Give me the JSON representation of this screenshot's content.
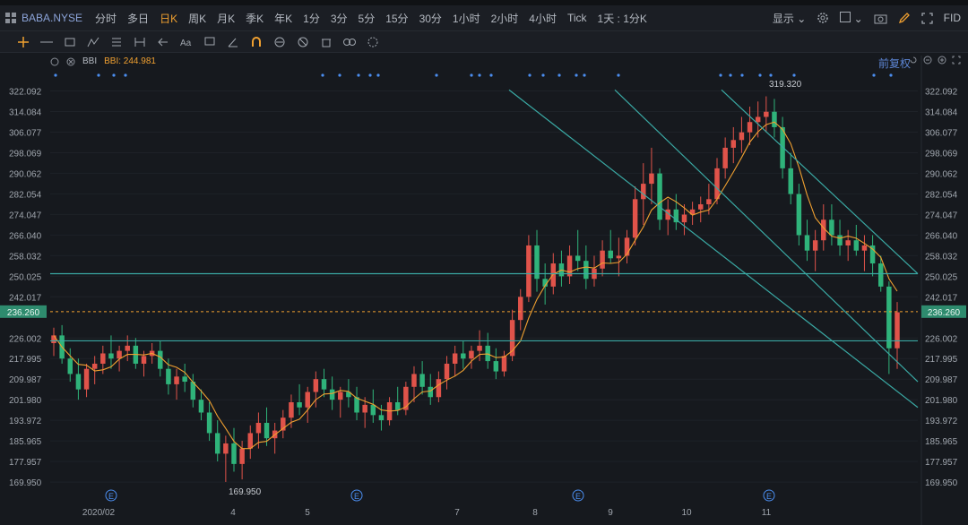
{
  "header": {
    "symbol": "BABA.NYSE",
    "timeframes": [
      "分时",
      "多日",
      "日K",
      "周K",
      "月K",
      "季K",
      "年K",
      "1分",
      "3分",
      "5分",
      "15分",
      "30分",
      "1小时",
      "2小时",
      "4小时",
      "Tick",
      "1天 : 1分K"
    ],
    "active_timeframe": "日K",
    "display_label": "显示",
    "fid_label": "FID"
  },
  "indicator": {
    "name": "BBI",
    "value_label": "BBI: 244.981"
  },
  "adjust_label": "前复权",
  "colors": {
    "up": "#e0534a",
    "down": "#2fb37a",
    "ma": "#f0a030",
    "trendline": "#3aa9a4",
    "price_tag": "#2e8b6e",
    "axis_text": "#a0a6ae",
    "background": "#16191e",
    "marker_dot": "#4b8ef0"
  },
  "chart_data": {
    "type": "candlestick",
    "yticks": [
      322.092,
      314.084,
      306.077,
      298.069,
      290.062,
      282.054,
      274.047,
      266.04,
      258.032,
      250.025,
      242.017,
      226.002,
      217.995,
      209.987,
      201.98,
      193.972,
      185.965,
      177.957,
      169.95
    ],
    "ylim": [
      166.5,
      327.5
    ],
    "xtick_labels": [
      "2020/02",
      "4",
      "5",
      "7",
      "8",
      "9",
      "10",
      "11"
    ],
    "current_price": "236.260",
    "annotations": [
      {
        "text": "319.320",
        "kind": "high",
        "value": 319.32
      },
      {
        "text": "169.950",
        "kind": "low",
        "value": 169.95
      }
    ],
    "earnings_marker": "E",
    "horizontal_lines": [
      251.0,
      224.9
    ],
    "channel_lines": [
      {
        "from": [
          "2020-07-08",
          322.5
        ],
        "to": [
          "2020-12-15",
          199.0
        ]
      },
      {
        "from": [
          "2020-09-07",
          322.5
        ],
        "to": [
          "2020-12-15",
          209.0
        ]
      },
      {
        "from": [
          "2020-10-19",
          322.5
        ],
        "to": [
          "2020-12-15",
          251.0
        ]
      }
    ],
    "ohlc": [
      [
        224,
        230,
        219,
        227
      ],
      [
        227,
        231,
        216,
        218
      ],
      [
        218,
        222,
        209,
        212
      ],
      [
        212,
        218,
        202,
        206
      ],
      [
        206,
        216,
        203,
        214
      ],
      [
        214,
        219,
        208,
        216
      ],
      [
        216,
        223,
        212,
        220
      ],
      [
        220,
        227,
        214,
        218
      ],
      [
        218,
        223,
        213,
        221
      ],
      [
        221,
        227,
        217,
        223
      ],
      [
        223,
        226,
        214,
        216
      ],
      [
        216,
        221,
        211,
        219
      ],
      [
        219,
        224,
        216,
        221
      ],
      [
        221,
        225,
        211,
        214
      ],
      [
        214,
        218,
        204,
        208
      ],
      [
        208,
        214,
        202,
        211
      ],
      [
        211,
        216,
        205,
        209
      ],
      [
        209,
        212,
        199,
        202
      ],
      [
        202,
        206,
        194,
        197
      ],
      [
        197,
        201,
        186,
        189
      ],
      [
        189,
        194,
        178,
        181
      ],
      [
        181,
        188,
        170,
        185
      ],
      [
        185,
        191,
        174,
        177
      ],
      [
        177,
        186,
        171,
        183
      ],
      [
        183,
        192,
        179,
        189
      ],
      [
        189,
        197,
        183,
        193
      ],
      [
        193,
        199,
        184,
        187
      ],
      [
        187,
        193,
        181,
        190
      ],
      [
        190,
        198,
        187,
        195
      ],
      [
        195,
        204,
        191,
        201
      ],
      [
        201,
        208,
        196,
        199
      ],
      [
        199,
        207,
        193,
        205
      ],
      [
        205,
        213,
        199,
        210
      ],
      [
        210,
        214,
        203,
        206
      ],
      [
        206,
        211,
        198,
        202
      ],
      [
        202,
        207,
        195,
        205
      ],
      [
        205,
        210,
        199,
        203
      ],
      [
        203,
        207,
        194,
        197
      ],
      [
        197,
        203,
        191,
        200
      ],
      [
        200,
        206,
        193,
        196
      ],
      [
        196,
        200,
        190,
        194
      ],
      [
        194,
        203,
        192,
        201
      ],
      [
        201,
        207,
        196,
        198
      ],
      [
        198,
        209,
        196,
        207
      ],
      [
        207,
        215,
        201,
        212
      ],
      [
        212,
        217,
        204,
        207
      ],
      [
        207,
        212,
        200,
        203
      ],
      [
        203,
        213,
        201,
        210
      ],
      [
        210,
        219,
        206,
        216
      ],
      [
        216,
        223,
        211,
        220
      ],
      [
        220,
        225,
        214,
        218
      ],
      [
        218,
        223,
        214,
        221
      ],
      [
        221,
        229,
        217,
        223
      ],
      [
        223,
        228,
        214,
        217
      ],
      [
        217,
        222,
        210,
        213
      ],
      [
        213,
        221,
        211,
        219
      ],
      [
        219,
        237,
        217,
        233
      ],
      [
        233,
        245,
        229,
        242
      ],
      [
        242,
        266,
        240,
        262
      ],
      [
        262,
        268,
        244,
        249
      ],
      [
        249,
        255,
        239,
        246
      ],
      [
        246,
        259,
        243,
        255
      ],
      [
        255,
        260,
        246,
        250
      ],
      [
        250,
        262,
        247,
        258
      ],
      [
        258,
        268,
        252,
        256
      ],
      [
        256,
        262,
        245,
        249
      ],
      [
        249,
        258,
        246,
        253
      ],
      [
        253,
        264,
        250,
        260
      ],
      [
        260,
        268,
        255,
        257
      ],
      [
        257,
        265,
        250,
        258
      ],
      [
        258,
        268,
        255,
        265
      ],
      [
        265,
        285,
        262,
        280
      ],
      [
        280,
        294,
        270,
        286
      ],
      [
        286,
        300,
        278,
        290
      ],
      [
        290,
        292,
        268,
        272
      ],
      [
        272,
        280,
        266,
        276
      ],
      [
        276,
        282,
        268,
        271
      ],
      [
        271,
        278,
        266,
        274
      ],
      [
        274,
        279,
        270,
        276
      ],
      [
        276,
        281,
        271,
        278
      ],
      [
        278,
        286,
        274,
        280
      ],
      [
        280,
        296,
        278,
        292
      ],
      [
        292,
        304,
        288,
        300
      ],
      [
        300,
        308,
        294,
        303
      ],
      [
        303,
        312,
        298,
        306
      ],
      [
        306,
        316,
        301,
        310
      ],
      [
        310,
        318,
        304,
        312
      ],
      [
        312,
        320,
        306,
        314
      ],
      [
        314,
        319,
        304,
        308
      ],
      [
        308,
        312,
        288,
        292
      ],
      [
        292,
        298,
        278,
        282
      ],
      [
        282,
        286,
        262,
        266
      ],
      [
        266,
        272,
        256,
        260
      ],
      [
        260,
        268,
        252,
        264
      ],
      [
        264,
        278,
        260,
        272
      ],
      [
        272,
        278,
        262,
        266
      ],
      [
        266,
        272,
        258,
        262
      ],
      [
        262,
        268,
        256,
        264
      ],
      [
        264,
        270,
        258,
        260
      ],
      [
        260,
        266,
        252,
        262
      ],
      [
        262,
        266,
        250,
        255
      ],
      [
        255,
        258,
        244,
        246
      ],
      [
        246,
        248,
        212,
        222
      ],
      [
        222,
        240,
        214,
        236
      ]
    ]
  }
}
